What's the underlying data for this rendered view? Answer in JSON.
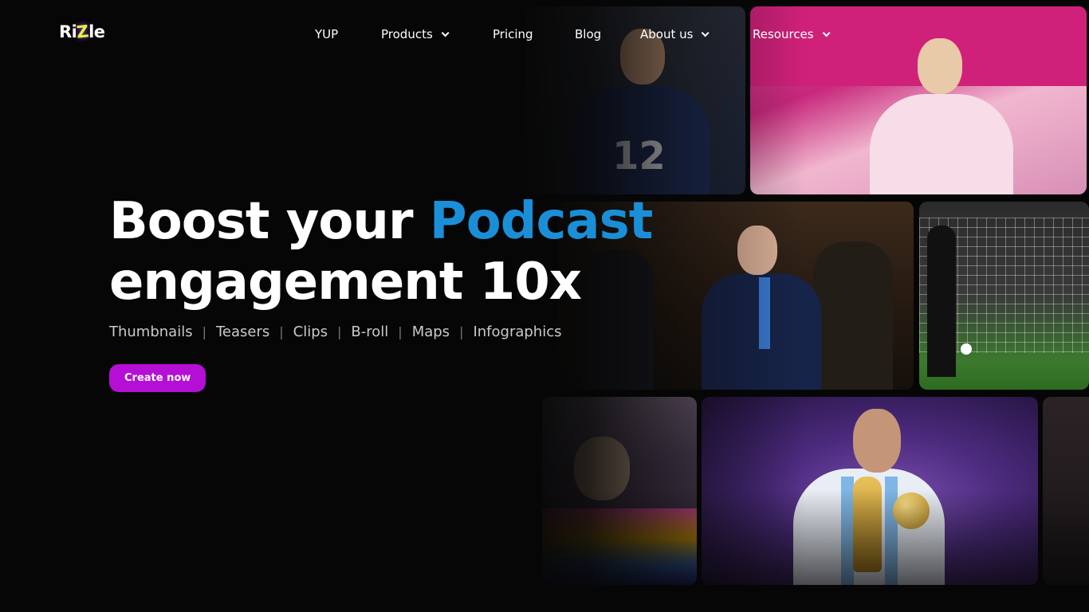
{
  "brand": {
    "name_prefix": "Ri",
    "name_z": "Z",
    "name_suffix": "le"
  },
  "nav": {
    "items": [
      {
        "label": "YUP",
        "has_dropdown": false
      },
      {
        "label": "Products",
        "has_dropdown": true
      },
      {
        "label": "Pricing",
        "has_dropdown": false
      },
      {
        "label": "Blog",
        "has_dropdown": false
      },
      {
        "label": "About us",
        "has_dropdown": true
      },
      {
        "label": "Resources",
        "has_dropdown": true
      }
    ]
  },
  "hero": {
    "headline_part1": "Boost your ",
    "headline_accent": "Podcast",
    "headline_part2": "engagement 10x",
    "tags": [
      "Thumbnails",
      "Teasers",
      "Clips",
      "B-roll",
      "Maps",
      "Infographics"
    ],
    "separator": "|",
    "cta_label": "Create now"
  },
  "collage": {
    "jersey_number": "12"
  },
  "colors": {
    "background": "#060606",
    "accent_blue": "#1a8fd8",
    "cta_purple": "#b50fd6",
    "logo_z": "#d7ff3a"
  }
}
